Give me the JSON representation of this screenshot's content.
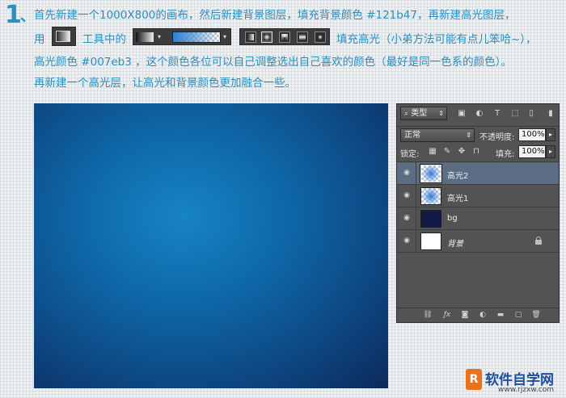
{
  "step": {
    "number": "1",
    "separator": "、"
  },
  "text": {
    "line1": "首先新建一个1000X800的画布，然后新建背景图层，填充背景颜色 #121b47，再新建高光图层，",
    "line2a": "用",
    "line2b": "工具中的",
    "line2c": "填充高光（小弟方法可能有点儿笨哈~），",
    "line3": "高光颜色 #007eb3 ，这个颜色各位可以自己调整选出自己喜欢的颜色（最好是同一色系的颜色）。",
    "line4": "再新建一个高光层，让高光和背景颜色更加融合一些。"
  },
  "colors": {
    "accent_text": "#2a8fbd",
    "background_fill": "#121b47",
    "highlight_fill": "#007eb3",
    "panel_bg": "#535353",
    "selected_layer": "#5a6d85"
  },
  "toolbar": {
    "gradient_modes": [
      "linear-gradient-icon",
      "radial-gradient-icon",
      "angle-gradient-icon",
      "reflected-gradient-icon",
      "diamond-gradient-icon"
    ],
    "active_mode": "radial-gradient-icon"
  },
  "layers_panel": {
    "filter_label": "类型",
    "blend_mode": "正常",
    "opacity_label": "不透明度:",
    "opacity_value": "100%",
    "lock_label": "锁定:",
    "fill_label": "填充:",
    "fill_value": "100%",
    "layers": [
      {
        "name": "高光2",
        "thumb": "highlight",
        "selected": true,
        "italic": false,
        "locked": false
      },
      {
        "name": "高光1",
        "thumb": "highlight",
        "selected": false,
        "italic": false,
        "locked": false
      },
      {
        "name": "bg",
        "thumb": "#121b47",
        "selected": false,
        "italic": false,
        "locked": false
      },
      {
        "name": "背景",
        "thumb": "#ffffff",
        "selected": false,
        "italic": true,
        "locked": true
      }
    ]
  },
  "watermark": {
    "logo": "R",
    "title": "软件自学网",
    "url": "www.rjzxw.com"
  }
}
